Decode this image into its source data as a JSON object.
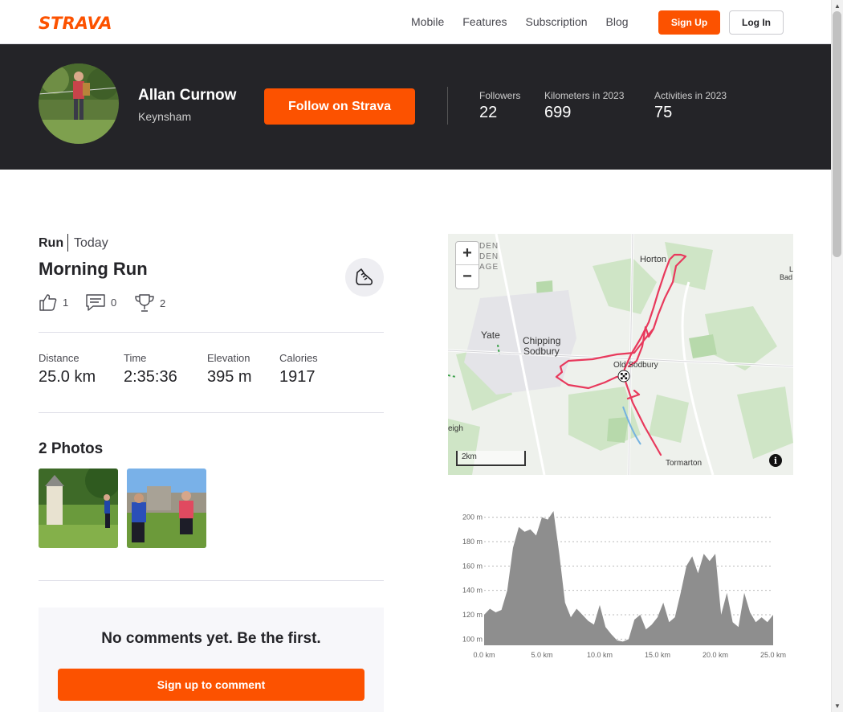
{
  "nav": {
    "logo": "STRAVA",
    "links": [
      "Mobile",
      "Features",
      "Subscription",
      "Blog"
    ],
    "signup": "Sign Up",
    "login": "Log In"
  },
  "athlete": {
    "name": "Allan Curnow",
    "location": "Keynsham",
    "follow": "Follow on Strava",
    "stats": [
      {
        "label": "Followers",
        "value": "22"
      },
      {
        "label": "Kilometers in 2023",
        "value": "699"
      },
      {
        "label": "Activities in 2023",
        "value": "75"
      }
    ]
  },
  "activity": {
    "type": "Run",
    "date": "Today",
    "title": "Morning Run",
    "kudos": "1",
    "comments": "0",
    "achievements": "2",
    "stats": [
      {
        "label": "Distance",
        "value": "25.0 km"
      },
      {
        "label": "Time",
        "value": "2:35:36"
      },
      {
        "label": "Elevation",
        "value": "395 m"
      },
      {
        "label": "Calories",
        "value": "1917"
      }
    ],
    "photos_heading": "2 Photos"
  },
  "comments": {
    "empty": "No comments yet. Be the first.",
    "signup": "Sign up to comment"
  },
  "map": {
    "zoom_in": "+",
    "zoom_out": "−",
    "labels": {
      "horton": "Horton",
      "yate": "Yate",
      "chipping": "Chipping",
      "sodbury": "Sodbury",
      "old_sodbury": "Old Sodbury",
      "tormarton": "Tormarton",
      "eigh": "eigh",
      "den": "DEN",
      "den2": "DEN",
      "age": "AGE",
      "bad": "Bad",
      "l": "L"
    },
    "scale": "2km",
    "info": "i"
  },
  "chart_data": {
    "type": "area",
    "xlabel": "",
    "ylabel": "",
    "x_ticks": [
      "0.0 km",
      "5.0 km",
      "10.0 km",
      "15.0 km",
      "20.0 km",
      "25.0 km"
    ],
    "y_ticks": [
      "100 m",
      "120 m",
      "140 m",
      "160 m",
      "180 m",
      "200 m"
    ],
    "xlim": [
      0,
      25
    ],
    "ylim": [
      95,
      205
    ],
    "x": [
      0,
      0.5,
      1,
      1.5,
      2,
      2.5,
      3,
      3.5,
      4,
      4.5,
      5,
      5.5,
      6,
      6.5,
      7,
      7.5,
      8,
      8.5,
      9,
      9.5,
      10,
      10.5,
      11,
      11.5,
      12,
      12.5,
      13,
      13.5,
      14,
      14.5,
      15,
      15.5,
      16,
      16.5,
      17,
      17.5,
      18,
      18.5,
      19,
      19.5,
      20,
      20.5,
      21,
      21.5,
      22,
      22.5,
      23,
      23.5,
      24,
      24.5,
      25
    ],
    "y": [
      120,
      125,
      122,
      124,
      140,
      175,
      192,
      188,
      190,
      185,
      200,
      198,
      205,
      170,
      130,
      118,
      125,
      120,
      115,
      112,
      128,
      110,
      104,
      99,
      98,
      100,
      116,
      120,
      108,
      112,
      118,
      130,
      114,
      118,
      138,
      160,
      168,
      154,
      170,
      164,
      170,
      120,
      138,
      114,
      110,
      138,
      122,
      114,
      118,
      114,
      120
    ],
    "grid": true
  }
}
